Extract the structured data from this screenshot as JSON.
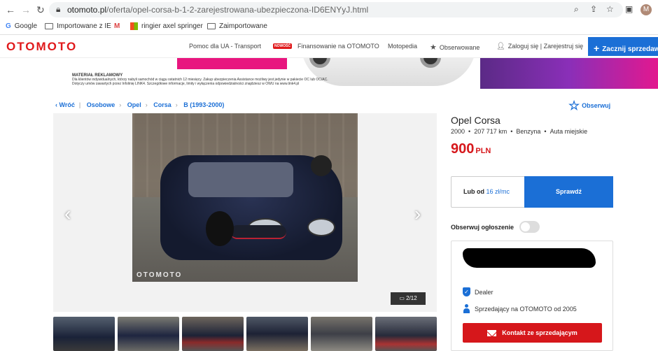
{
  "browser": {
    "url_domain": "otomoto.pl",
    "url_path": "/oferta/opel-corsa-b-1-2-zarejestrowana-ubezpieczona-ID6ENYyJ.html",
    "profile_initial": "M",
    "bookmarks": [
      "Google",
      "Importowane z IE",
      "ringier axel springer",
      "Zaimportowane"
    ]
  },
  "header": {
    "logo": "OTOMOTO",
    "nav": [
      "Pomoc dla UA - Transport",
      "Finansowanie na OTOMOTO",
      "Motopedia",
      "Obserwowane",
      "Zaloguj się | Zarejestruj się"
    ],
    "new_badge": "NOWOŚĆ",
    "cta": "Zacznij sprzedawać"
  },
  "ad": {
    "heading": "MATERIAŁ REKLAMOWY",
    "lines": [
      "Dla klientów indywidualnych, którzy nabyli samochód w ciągu ostatnich 12 miesięcy. Zakup ubezpieczenia Assistance możliwy jest jedynie w pakiecie OC lub OC/AC.",
      "Dotyczy umów zawartych przez Infolinię LINK4. Szczegółowe informacje, limity i wyłączenia odpowiedzialności znajdziesz w OWU na www.link4.pl"
    ]
  },
  "breadcrumb": [
    "Wróć",
    "Osobowe",
    "Opel",
    "Corsa",
    "B (1993-2000)"
  ],
  "observe_top": "Obserwuj",
  "gallery": {
    "watermark": "OTOMOTO",
    "counter": "2/12"
  },
  "listing": {
    "title": "Opel Corsa",
    "params": [
      "2000",
      "207 717 km",
      "Benzyna",
      "Auta miejskie"
    ],
    "price": "900",
    "currency": "PLN"
  },
  "finance": {
    "prefix": "Lub od",
    "rate": "16 zł/mc",
    "button": "Sprawdź"
  },
  "follow": {
    "label": "Obserwuj ogłoszenie",
    "enabled": false
  },
  "seller": {
    "type": "Dealer",
    "since": "Sprzedający na OTOMOTO od 2005",
    "contact": "Kontakt ze sprzedającym"
  },
  "colors": {
    "accent_blue": "#1b6fd6",
    "brand_red": "#d6171b"
  }
}
